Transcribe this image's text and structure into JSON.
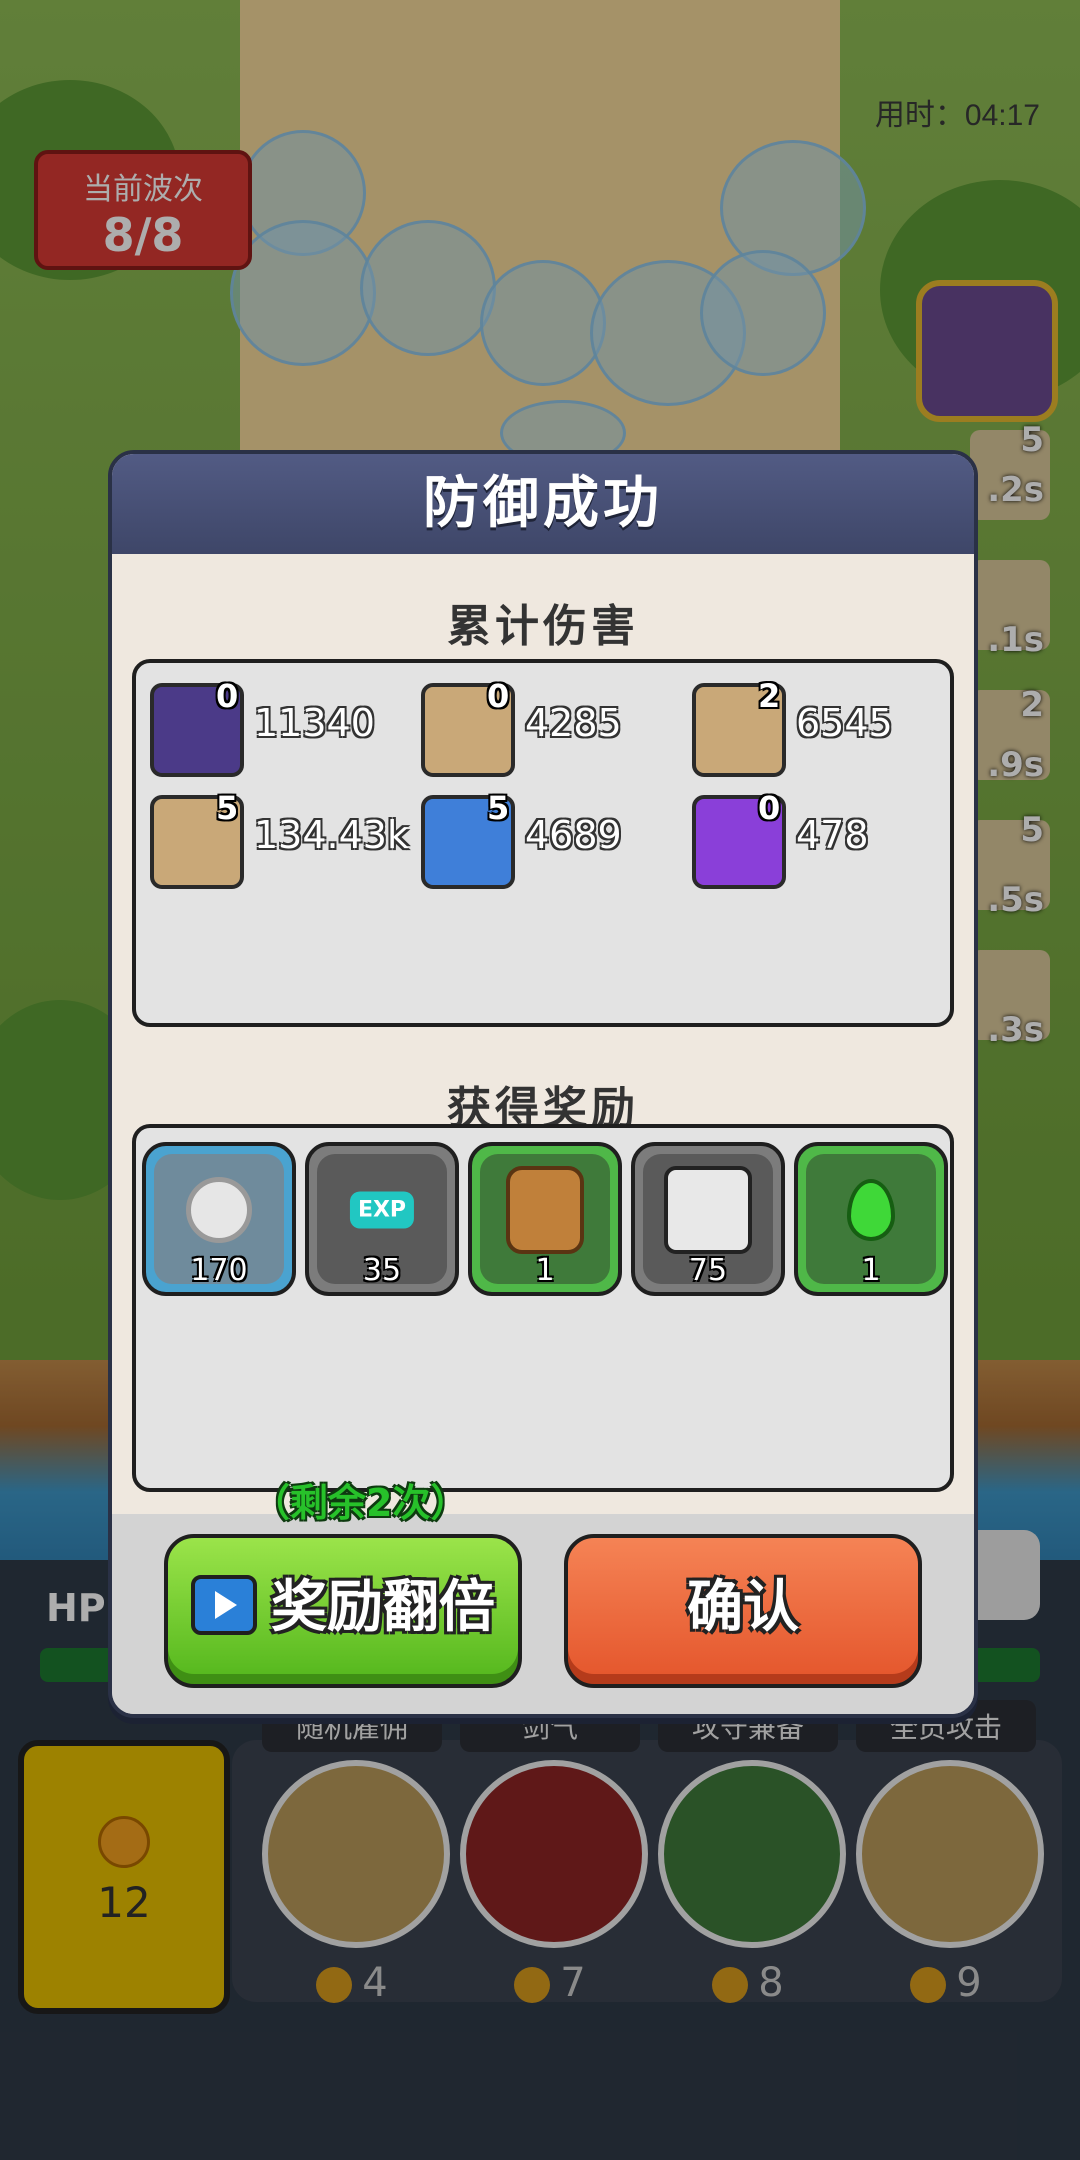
{
  "hud": {
    "timer": "用时：04:17",
    "wave_title": "当前波次",
    "wave_value": "8/8",
    "hp_label": "HP",
    "coins": "12"
  },
  "side_queue": [
    "5",
    ".2s",
    ".1s",
    "2",
    ".9s",
    "5",
    ".5s",
    ".3s"
  ],
  "skills": [
    {
      "name": "随机雇佣",
      "cost": "4"
    },
    {
      "name": "剑气",
      "cost": "7"
    },
    {
      "name": "攻守兼备",
      "cost": "8"
    },
    {
      "name": "全员攻击",
      "cost": "9"
    }
  ],
  "modal": {
    "title": "防御成功",
    "damage_title": "累计伤害",
    "damage": [
      {
        "stars": "0",
        "value": "11340",
        "color": "#4b3a88",
        "icon": "archer-portrait-icon"
      },
      {
        "stars": "0",
        "value": "4285",
        "color": "#c9a878",
        "icon": "farmer-portrait-icon"
      },
      {
        "stars": "2",
        "value": "6545",
        "color": "#c9a878",
        "icon": "knight-portrait-icon"
      },
      {
        "stars": "5",
        "value": "134.43k",
        "color": "#c9a878",
        "icon": "wizard-portrait-icon"
      },
      {
        "stars": "5",
        "value": "4689",
        "color": "#3f7fd9",
        "icon": "nurse-portrait-icon"
      },
      {
        "stars": "0",
        "value": "478",
        "color": "#8a3fd9",
        "icon": "lightning-skill-icon"
      }
    ],
    "reward_title": "获得奖励",
    "rewards": [
      {
        "qty": "170",
        "icon": "star-coin-icon",
        "frame": "#4aa3d0"
      },
      {
        "qty": "35",
        "icon": "exp-icon",
        "frame": "#7c7c7c",
        "label": "EXP"
      },
      {
        "qty": "1",
        "icon": "armor-icon",
        "frame": "#4fb848"
      },
      {
        "qty": "75",
        "icon": "knight-fragment-icon",
        "frame": "#7c7c7c"
      },
      {
        "qty": "1",
        "icon": "green-gem-icon",
        "frame": "#4fb848"
      }
    ],
    "remaining": "（剩余2次）",
    "double_reward_label": "奖励翻倍",
    "confirm_label": "确认"
  }
}
